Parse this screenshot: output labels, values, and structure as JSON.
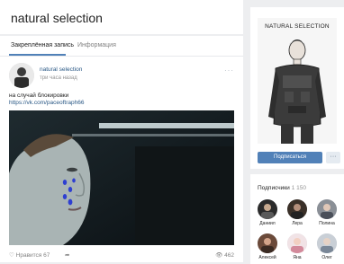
{
  "group": {
    "title": "natural selection"
  },
  "tabs": [
    {
      "label": "Закреплённая запись"
    },
    {
      "label": "Информация"
    }
  ],
  "post": {
    "author": "natural selection",
    "time": "три часа назад",
    "text": "на случай блокировки",
    "link": "https://vk.com/paceoftraph66",
    "menu_icon": "ellipsis-icon",
    "likes_label": "Нравится",
    "likes_count": "67",
    "views_count": "462"
  },
  "cover": {
    "title": "NATURAL SELECTION"
  },
  "actions": {
    "subscribe_label": "Подписаться",
    "more_label": "···"
  },
  "members": {
    "title": "Подписчики",
    "count": "1 150",
    "list": [
      {
        "name": "Даниил"
      },
      {
        "name": "Лера"
      },
      {
        "name": "Полина"
      },
      {
        "name": "Алексей"
      },
      {
        "name": "Яна"
      },
      {
        "name": "Олег"
      }
    ]
  },
  "colors": {
    "accent": "#5181b8",
    "link": "#2a5885",
    "background": "#edeef0"
  }
}
